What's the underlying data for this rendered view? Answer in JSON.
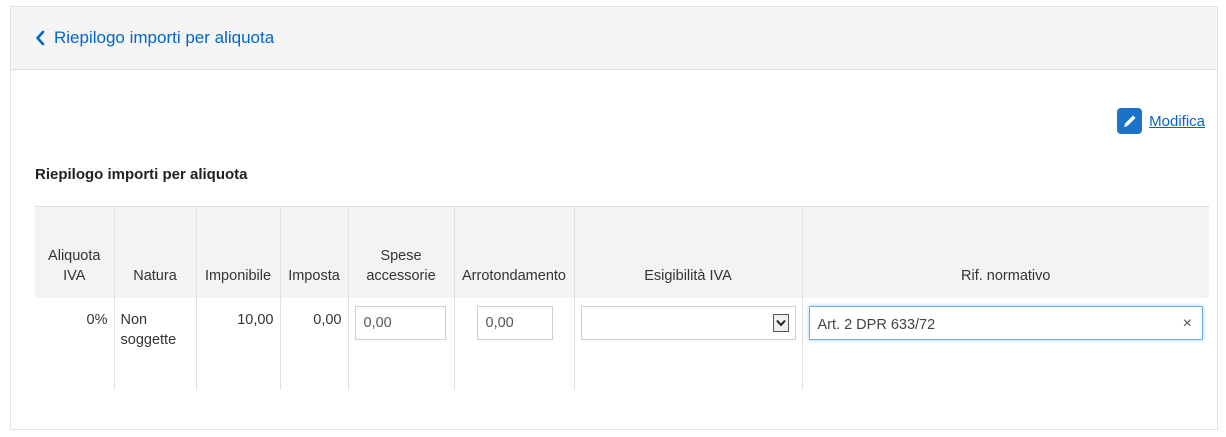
{
  "header": {
    "back_label": "Riepilogo importi per aliquota"
  },
  "actions": {
    "modifica_label": "Modifica"
  },
  "section": {
    "title": "Riepilogo importi per aliquota"
  },
  "table": {
    "headers": {
      "aliquota": "Aliquota IVA",
      "natura": "Natura",
      "imponibile": "Imponibile",
      "imposta": "Imposta",
      "spese": "Spese accessorie",
      "arrotondamento": "Arrotondamento",
      "esigibilita": "Esigibilità IVA",
      "rif": "Rif. normativo"
    },
    "row": {
      "aliquota": "0%",
      "natura": "Non soggette",
      "imponibile": "10,00",
      "imposta": "0,00",
      "spese_value": "0,00",
      "arrotondamento_value": "0,00",
      "esigibilita_value": "",
      "rif_value": "Art. 2 DPR 633/72",
      "clear_label": "×"
    }
  },
  "colors": {
    "link": "#0066cc",
    "accent": "#1a73c8",
    "focus_border": "#66afe9"
  },
  "icons": {
    "back": "chevron-left-icon",
    "edit": "pencil-icon",
    "dropdown": "caret-down-icon",
    "clear": "close-icon"
  }
}
